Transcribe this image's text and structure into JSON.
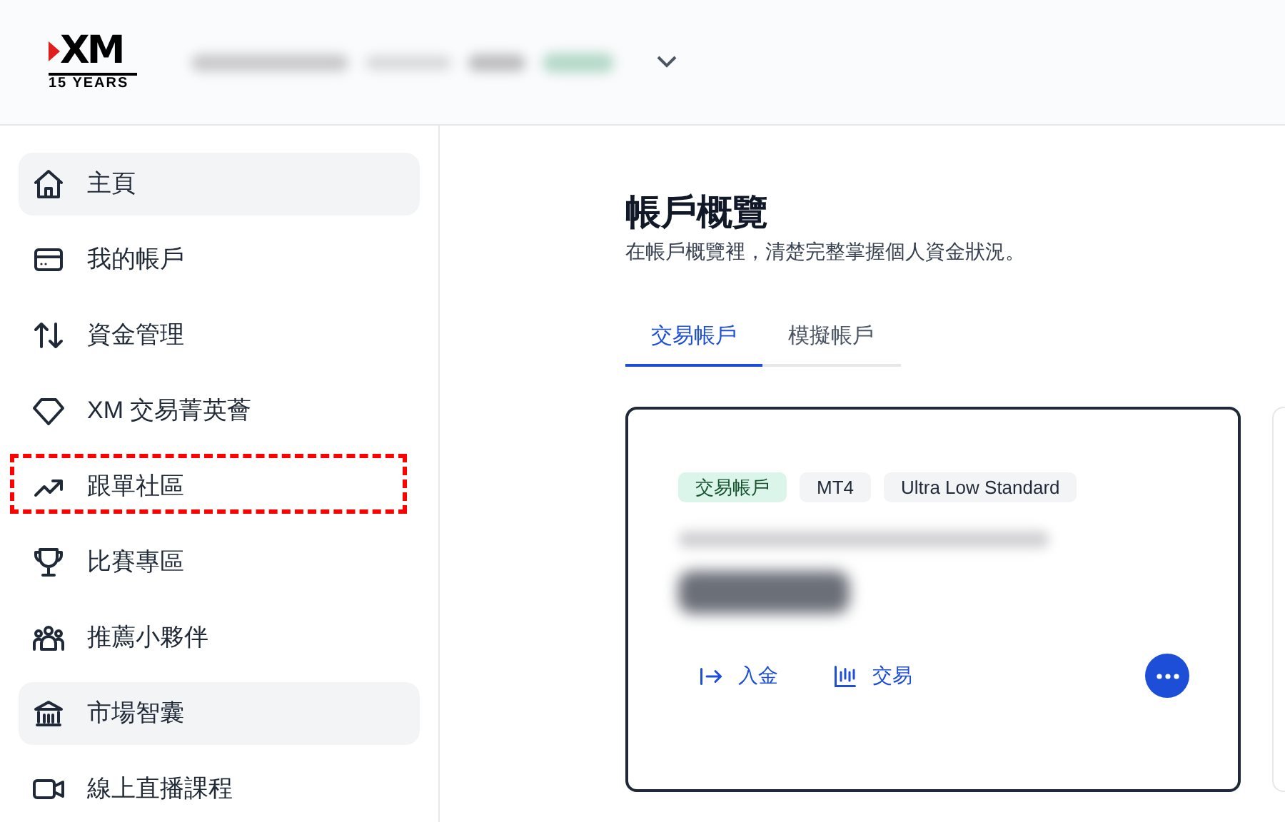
{
  "logo": {
    "mark": "XM",
    "subtitle": "15 YEARS"
  },
  "sidebar": {
    "items": [
      {
        "label": "主頁",
        "kind": "home",
        "selected": true,
        "annotated": false
      },
      {
        "label": "我的帳戶",
        "kind": "card",
        "selected": false,
        "annotated": false
      },
      {
        "label": "資金管理",
        "kind": "transfer",
        "selected": false,
        "annotated": false
      },
      {
        "label": "XM 交易菁英薈",
        "kind": "diamond",
        "selected": false,
        "annotated": false
      },
      {
        "label": "跟單社區",
        "kind": "trend",
        "selected": false,
        "annotated": true
      },
      {
        "label": "比賽專區",
        "kind": "trophy",
        "selected": false,
        "annotated": false
      },
      {
        "label": "推薦小夥伴",
        "kind": "people",
        "selected": false,
        "annotated": false
      },
      {
        "label": "市場智囊",
        "kind": "bank",
        "selected": true,
        "annotated": false
      },
      {
        "label": "線上直播課程",
        "kind": "video",
        "selected": false,
        "annotated": false
      }
    ]
  },
  "page": {
    "title": "帳戶概覽",
    "subtitle": "在帳戶概覽裡，清楚完整掌握個人資金狀況。"
  },
  "tabs": [
    {
      "label": "交易帳戶",
      "selected": true
    },
    {
      "label": "模擬帳戶",
      "selected": false
    }
  ],
  "account_card": {
    "tags": [
      {
        "label": "交易帳戶",
        "kind": "type"
      },
      {
        "label": "MT4",
        "kind": "plain"
      },
      {
        "label": "Ultra Low Standard",
        "kind": "plain"
      }
    ],
    "actions": [
      {
        "label": "入金",
        "kind": "deposit"
      },
      {
        "label": "交易",
        "kind": "chart"
      }
    ]
  }
}
